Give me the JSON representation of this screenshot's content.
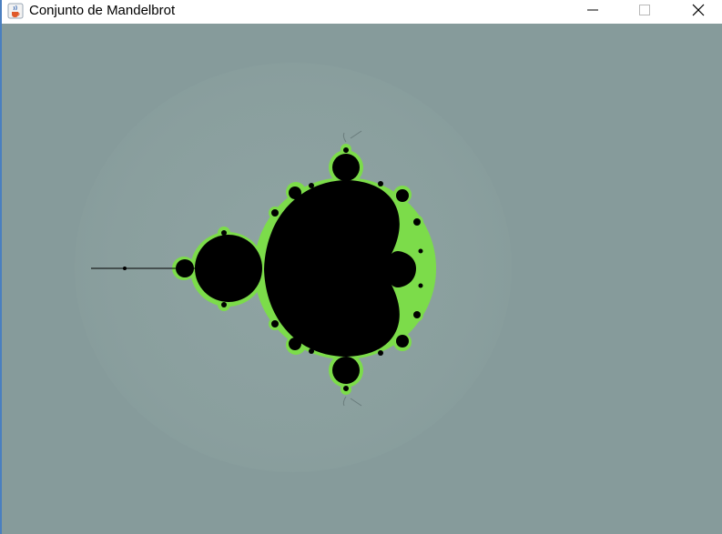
{
  "window": {
    "title": "Conjunto de Mandelbrot",
    "app_icon": "java-cup-icon",
    "controls": {
      "minimize_icon": "minimize-icon",
      "maximize_icon": "maximize-icon",
      "close_icon": "close-icon"
    }
  },
  "canvas": {
    "content": "mandelbrot-set",
    "colors": {
      "background": "#869b9b",
      "halo": "#8ea3a2",
      "set_fill": "#000000",
      "boundary": "#7cdc4a"
    }
  }
}
